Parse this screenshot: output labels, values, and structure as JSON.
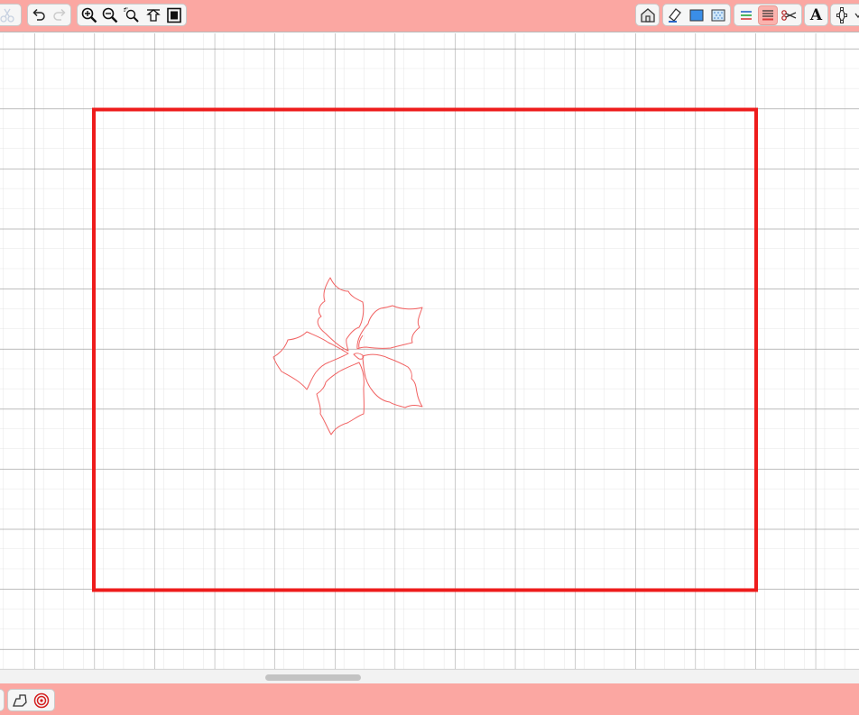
{
  "colors": {
    "toolbar_bg": "#fba7a2",
    "page_border": "#ee1c1c",
    "design_stroke": "#f16262",
    "grid_major": "#8a8a8a",
    "grid_minor": "#d6d6d6"
  },
  "top_toolbar": {
    "left_groups": [
      [
        "scissors-icon"
      ],
      [
        "undo-icon",
        "redo-icon"
      ],
      [
        "zoom-in-icon",
        "zoom-out-icon",
        "zoom-fit-icon",
        "pan-icon",
        "page-view-icon"
      ]
    ],
    "right_groups": [
      [
        "home-icon"
      ],
      [
        "eraser-icon",
        "fill-color-icon",
        "fill-pattern-icon"
      ],
      [
        "line-color-icon",
        "line-style-icon",
        "cut-settings-icon"
      ],
      [
        "text-icon"
      ],
      [
        "node-edit-icon"
      ]
    ],
    "text_tool_glyph": "A",
    "selected_tool": "line-style-icon"
  },
  "bottom_toolbar": {
    "tools": [
      "shape-library-icon",
      "target-icon"
    ]
  }
}
